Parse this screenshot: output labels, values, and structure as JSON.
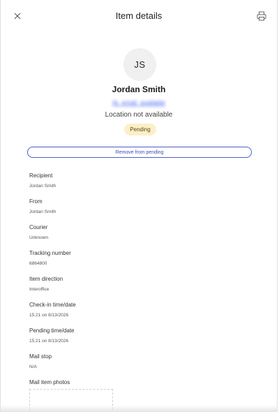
{
  "header": {
    "title": "Item details"
  },
  "profile": {
    "initials": "JS",
    "name": "Jordan Smith",
    "email": "jls_email_available",
    "location": "Location not available",
    "status": "Pending"
  },
  "actions": {
    "remove_label": "Remove from pending"
  },
  "details": [
    {
      "label": "Recipient",
      "value": "Jordan Smith"
    },
    {
      "label": "From",
      "value": "Jordan Smith"
    },
    {
      "label": "Courier",
      "value": "Unknown"
    },
    {
      "label": "Tracking number",
      "value": "6864800"
    },
    {
      "label": "Item direction",
      "value": "Interoffice"
    },
    {
      "label": "Check-in time/date",
      "value": "15:21 on 8/13/2026"
    },
    {
      "label": "Pending time/date",
      "value": "15:21 on 8/13/2026"
    },
    {
      "label": "Mail stop",
      "value": "N/A"
    }
  ],
  "photos": {
    "label": "Mail item photos"
  },
  "colors": {
    "accent": "#4b5fc2",
    "badge_bg": "#fdefc7"
  }
}
